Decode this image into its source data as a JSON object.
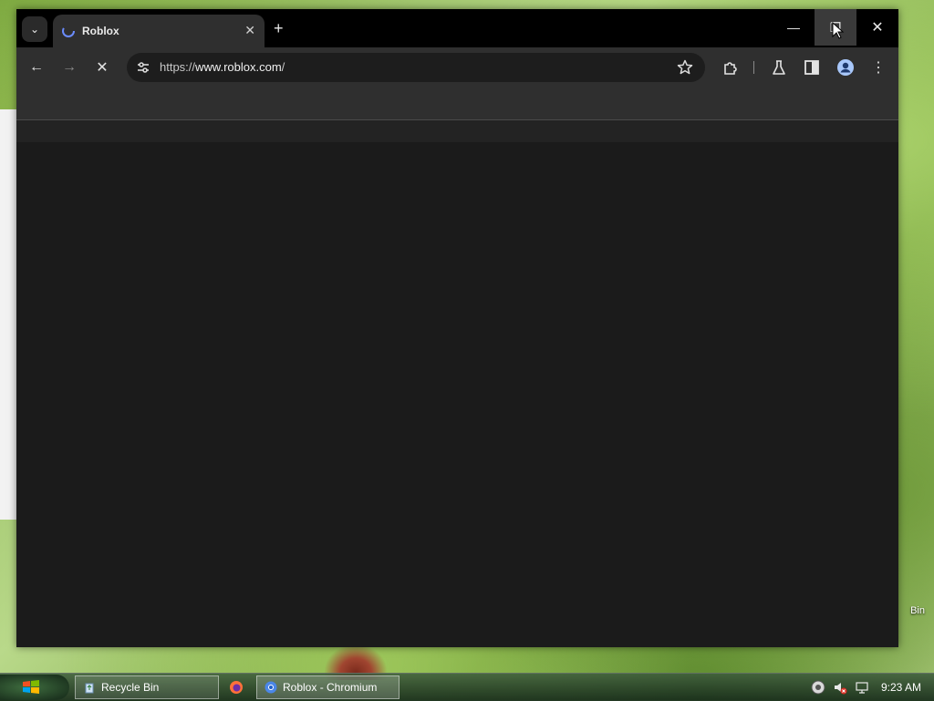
{
  "desktop": {
    "bin_label": "Bin"
  },
  "browser": {
    "tab": {
      "title": "Roblox",
      "close_glyph": "✕"
    },
    "tab_search_glyph": "⌄",
    "new_tab_glyph": "+",
    "window_controls": {
      "minimize": "—",
      "maximize": "❐",
      "close": "✕"
    },
    "toolbar": {
      "back_glyph": "←",
      "forward_glyph": "→",
      "stop_glyph": "✕",
      "url_scheme": "https://",
      "url_host": "www.roblox.com",
      "url_path": "/",
      "menu_glyph": "⋮"
    }
  },
  "taskbar": {
    "items": [
      {
        "label": "Recycle Bin"
      },
      {
        "label": "Roblox - Chromium"
      }
    ],
    "clock": "9:23 AM"
  },
  "colors": {
    "window_bg": "#1b1b1b",
    "titlebar_bg": "#000000",
    "toolbar_bg": "#2f2f2f",
    "omnibox_bg": "#1d1d1d"
  },
  "icons": [
    "tab-search-icon",
    "roblox-favicon",
    "close-icon",
    "plus-icon",
    "minimize-icon",
    "maximize-icon",
    "back-arrow-icon",
    "forward-arrow-icon",
    "stop-icon",
    "site-info-icon",
    "bookmark-star-icon",
    "extensions-icon",
    "labs-flask-icon",
    "side-panel-icon",
    "profile-icon",
    "kebab-menu-icon",
    "windows-start-icon",
    "recycle-bin-icon",
    "firefox-icon",
    "chromium-icon",
    "tray-network-icon",
    "volume-muted-icon",
    "action-center-icon",
    "mouse-pointer-icon"
  ]
}
